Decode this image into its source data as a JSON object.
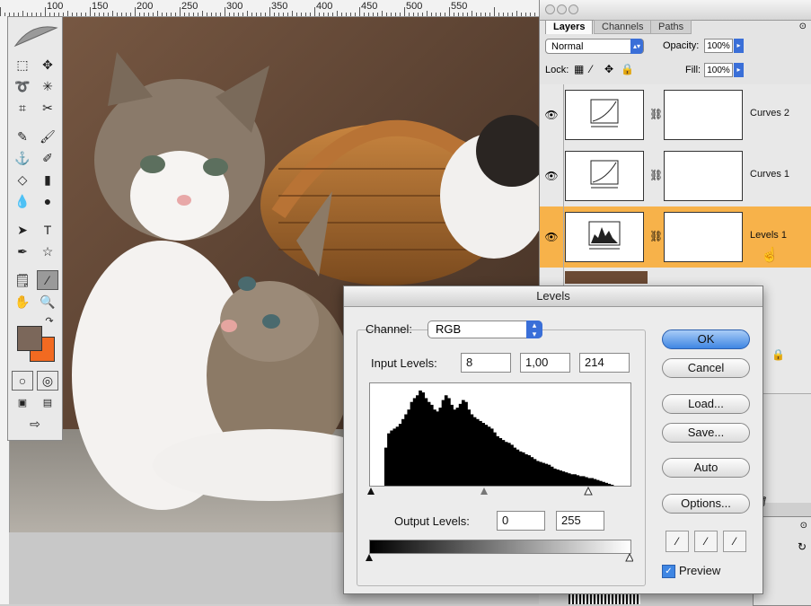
{
  "rulers": {
    "top_labels": [
      "100",
      "150",
      "200",
      "250",
      "300",
      "350",
      "400",
      "450",
      "500",
      "550"
    ]
  },
  "layers_panel": {
    "tabs": [
      "Layers",
      "Channels",
      "Paths"
    ],
    "blend_mode": "Normal",
    "opacity_label": "Opacity:",
    "opacity_value": "100%",
    "lock_label": "Lock:",
    "fill_label": "Fill:",
    "fill_value": "100%",
    "layers": [
      {
        "name": "Curves 2",
        "selected": false
      },
      {
        "name": "Curves 1",
        "selected": false
      },
      {
        "name": "Levels 1",
        "selected": true
      }
    ]
  },
  "levels_dialog": {
    "title": "Levels",
    "channel_label": "Channel:",
    "channel_value": "RGB",
    "input_label": "Input Levels:",
    "input_black": "8",
    "input_gamma": "1,00",
    "input_white": "214",
    "output_label": "Output Levels:",
    "output_black": "0",
    "output_white": "255",
    "buttons": {
      "ok": "OK",
      "cancel": "Cancel",
      "load": "Load...",
      "save": "Save...",
      "auto": "Auto",
      "options": "Options..."
    },
    "preview_label": "Preview",
    "preview_checked": true,
    "histogram": [
      0,
      0,
      0,
      0,
      0,
      40,
      55,
      58,
      60,
      62,
      65,
      70,
      75,
      80,
      88,
      92,
      95,
      100,
      98,
      92,
      88,
      85,
      80,
      78,
      82,
      90,
      95,
      92,
      85,
      80,
      82,
      86,
      90,
      88,
      80,
      75,
      72,
      70,
      68,
      66,
      64,
      62,
      60,
      56,
      52,
      50,
      48,
      46,
      45,
      43,
      40,
      38,
      36,
      35,
      33,
      32,
      30,
      28,
      26,
      25,
      24,
      23,
      22,
      20,
      18,
      17,
      16,
      15,
      14,
      13,
      12,
      12,
      11,
      10,
      10,
      9,
      8,
      8,
      7,
      6,
      5,
      4,
      3,
      2,
      1,
      0,
      0,
      0,
      0,
      0,
      0
    ]
  },
  "colors": {
    "foreground": "#7b675a",
    "background": "#f26a21",
    "selection": "#f7b24a",
    "accent": "#3a6fd8"
  }
}
